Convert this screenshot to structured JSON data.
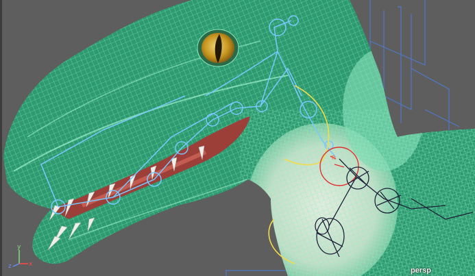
{
  "viewport": {
    "camera_label": "persp"
  },
  "axis_gizmo": {
    "x_label": "x",
    "y_label": "y",
    "z_label": "z"
  },
  "colors": {
    "background": "#5e5e5e",
    "mesh_wire": "#62e0a8",
    "mesh_fill": "#2f9a70",
    "skin_fill": "#cdd8c4",
    "mouth": "#9b3f38",
    "teeth": "#eeeeea",
    "eye_outer": "#d6b23a",
    "eye_pupil": "#231a05",
    "joint_wire": "#78c8ff",
    "ik_curve": "#f2dc4a",
    "ik_handle": "#e23030",
    "dark_controls": "#1c2038",
    "bbox_lines": "#4f78c8",
    "axis_x": "#ff4a4a",
    "axis_y": "#7ee07e",
    "axis_z": "#6a8aff"
  }
}
